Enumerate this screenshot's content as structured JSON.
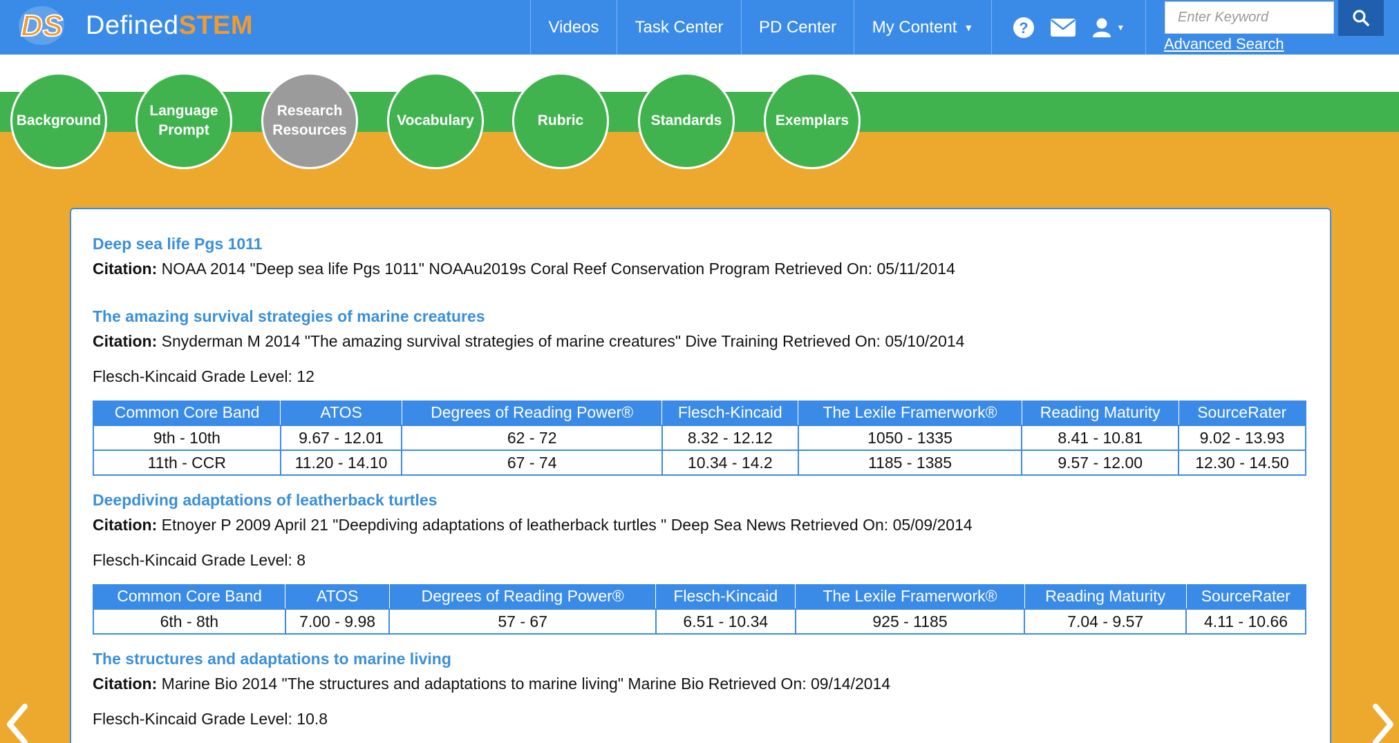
{
  "header": {
    "logo_mark": "DS",
    "logo_word_a": "Defined",
    "logo_word_b": "STEM",
    "nav": [
      {
        "label": "Videos"
      },
      {
        "label": "Task Center"
      },
      {
        "label": "PD Center"
      },
      {
        "label": "My Content"
      }
    ],
    "icons": [
      "help-icon",
      "mail-icon",
      "user-icon"
    ],
    "search_placeholder": "Enter Keyword",
    "advanced_search": "Advanced Search"
  },
  "tabs": [
    {
      "label": "Background"
    },
    {
      "label": "Language Prompt"
    },
    {
      "label": "Research Resources",
      "active": true
    },
    {
      "label": "Vocabulary"
    },
    {
      "label": "Rubric"
    },
    {
      "label": "Standards"
    },
    {
      "label": "Exemplars"
    }
  ],
  "columns": [
    "Common Core Band",
    "ATOS",
    "Degrees of Reading Power®",
    "Flesch-Kincaid",
    "The Lexile Framerwork®",
    "Reading Maturity",
    "SourceRater"
  ],
  "citation_label": "Citation:",
  "resources": [
    {
      "title": "Deep sea life Pgs 1011",
      "citation": "NOAA 2014 \"Deep sea life Pgs 1011\" NOAAu2019s Coral Reef Conservation Program Retrieved On: 05/11/2014"
    },
    {
      "title": "The amazing survival strategies of marine creatures",
      "citation": "Snyderman M 2014 \"The amazing survival strategies of marine creatures\" Dive Training Retrieved On: 05/10/2014",
      "grade_level": "Flesch-Kincaid Grade Level: 12",
      "rows": [
        [
          "9th - 10th",
          "9.67 - 12.01",
          "62 - 72",
          "8.32 - 12.12",
          "1050 - 1335",
          "8.41 - 10.81",
          "9.02 - 13.93"
        ],
        [
          "11th - CCR",
          "11.20 - 14.10",
          "67 - 74",
          "10.34 - 14.2",
          "1185 - 1385",
          "9.57 - 12.00",
          "12.30 - 14.50"
        ]
      ]
    },
    {
      "title": "Deepdiving adaptations of leatherback turtles",
      "citation": "Etnoyer P 2009 April 21 \"Deepdiving adaptations of leatherback turtles \" Deep Sea News Retrieved On: 05/09/2014",
      "grade_level": "Flesch-Kincaid Grade Level: 8",
      "rows": [
        [
          "6th - 8th",
          "7.00 - 9.98",
          "57 - 67",
          "6.51 - 10.34",
          "925 - 1185",
          "7.04 - 9.57",
          "4.11 - 10.66"
        ]
      ]
    },
    {
      "title": "The structures and adaptations to marine living",
      "citation": "Marine Bio 2014 \"The structures and adaptations to marine living\" Marine Bio Retrieved On: 09/14/2014",
      "grade_level": "Flesch-Kincaid Grade Level: 10.8"
    }
  ],
  "colors": {
    "nav_blue": "#3A8BE8",
    "tab_green": "#40B34F",
    "active_tab_gray": "#9B9B9B",
    "background_orange": "#ECA92E",
    "title_blue": "#3A8FD9",
    "logo_orange": "#F29A2E"
  }
}
